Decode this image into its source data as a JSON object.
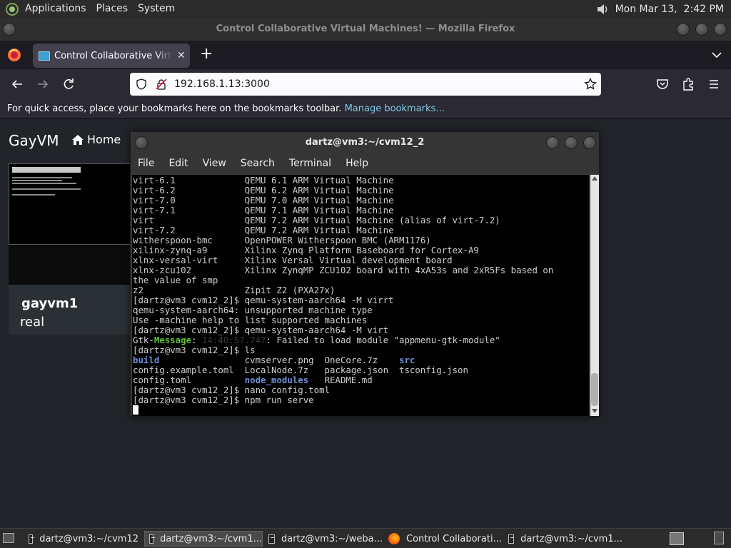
{
  "top_panel": {
    "menus": [
      "Applications",
      "Places",
      "System"
    ],
    "clock": "Mon Mar 13,  2:42 PM"
  },
  "firefox": {
    "window_title": "Control Collaborative Virtual Machines! — Mozilla Firefox",
    "tab_title": "Control Collaborative Virtual Machines!",
    "url": "192.168.1.13:3000",
    "bookmarks_hint": "For quick access, place your bookmarks here on the bookmarks toolbar.",
    "manage_bookmarks": "Manage bookmarks…"
  },
  "page": {
    "brand": "GayVM",
    "home": "Home",
    "vm": {
      "name": "gayvm1",
      "description": "real"
    }
  },
  "terminal": {
    "title": "dartz@vm3:~/cvm12_2",
    "menu": [
      "File",
      "Edit",
      "View",
      "Search",
      "Terminal",
      "Help"
    ],
    "lines": {
      "l0": "virt-6.1             QEMU 6.1 ARM Virtual Machine",
      "l1": "virt-6.2             QEMU 6.2 ARM Virtual Machine",
      "l2": "virt-7.0             QEMU 7.0 ARM Virtual Machine",
      "l3": "virt-7.1             QEMU 7.1 ARM Virtual Machine",
      "l4": "virt                 QEMU 7.2 ARM Virtual Machine (alias of virt-7.2)",
      "l5": "virt-7.2             QEMU 7.2 ARM Virtual Machine",
      "l6": "witherspoon-bmc      OpenPOWER Witherspoon BMC (ARM1176)",
      "l7": "xilinx-zynq-a9       Xilinx Zynq Platform Baseboard for Cortex-A9",
      "l8": "xlnx-versal-virt     Xilinx Versal Virtual development board",
      "l9": "xlnx-zcu102          Xilinx ZynqMP ZCU102 board with 4xA53s and 2xR5Fs based on",
      "l10": "the value of smp",
      "l11": "z2                   Zipit Z2 (PXA27x)",
      "l12": "[dartz@vm3 cvm12_2]$ qemu-system-aarch64 -M virrt",
      "l13": "qemu-system-aarch64: unsupported machine type",
      "l14": "Use -machine help to list supported machines",
      "l15": "[dartz@vm3 cvm12_2]$ qemu-system-aarch64 -M virt",
      "gtk_a": "Gtk-",
      "gtk_b": "Message",
      "gtk_c": ": ",
      "gtk_time": "14:40:57.747",
      "gtk_d": ": Failed to load module \"appmenu-gtk-module\"",
      "l17": "[dartz@vm3 cvm12_2]$ ls",
      "ls1_a": "build",
      "ls1_b": "                cvmserver.png  OneCore.7z    ",
      "ls1_c": "src",
      "l19": "config.example.toml  LocalNode.7z   package.json  tsconfig.json",
      "ls3_a": "config.toml          ",
      "ls3_b": "node_modules",
      "ls3_c": "   README.md",
      "l21": "[dartz@vm3 cvm12_2]$ nano config.toml",
      "l22": "[dartz@vm3 cvm12_2]$ npm run serve"
    }
  },
  "taskbar": {
    "tasks": [
      "dartz@vm3:~/cvm12",
      "dartz@vm3:~/cvm1...",
      "dartz@vm3:~/weba...",
      "Control Collaborati...",
      "dartz@vm3:~/cvm1..."
    ]
  }
}
